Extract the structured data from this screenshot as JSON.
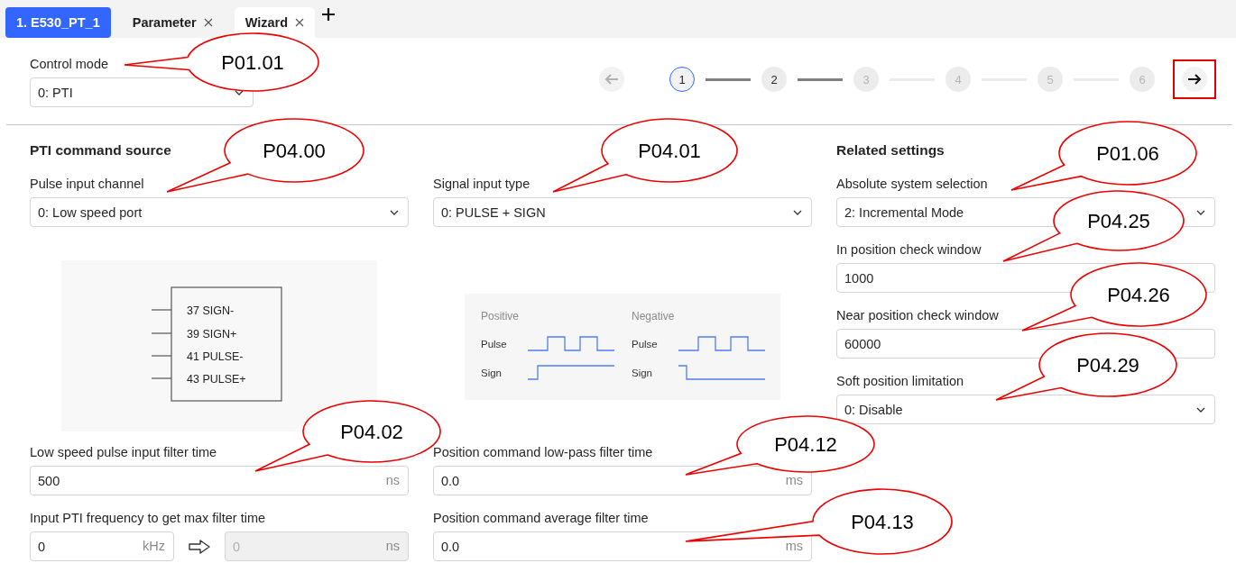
{
  "tabs": [
    {
      "label": "1. E530_PT_1",
      "kind": "device",
      "selected": false,
      "closable": false
    },
    {
      "label": "Parameter",
      "kind": "page",
      "selected": false,
      "closable": true
    },
    {
      "label": "Wizard",
      "kind": "page",
      "selected": true,
      "closable": true
    }
  ],
  "control_mode": {
    "label": "Control mode",
    "value": "0: PTI"
  },
  "stepper": {
    "back_disabled": true,
    "steps": [
      {
        "label": "1",
        "current": true,
        "disabled": false
      },
      {
        "label": "2",
        "current": false,
        "disabled": false
      },
      {
        "label": "3",
        "current": false,
        "disabled": true
      },
      {
        "label": "4",
        "current": false,
        "disabled": true
      },
      {
        "label": "5",
        "current": false,
        "disabled": true
      },
      {
        "label": "6",
        "current": false,
        "disabled": true
      }
    ],
    "next_highlighted": true
  },
  "main": {
    "heading": "PTI command source",
    "top_fields": [
      {
        "kind": "select",
        "label": "Pulse input channel",
        "value": "0: Low speed port"
      },
      {
        "kind": "select",
        "label": "Signal input type",
        "value": "0: PULSE + SIGN"
      }
    ],
    "diagrams": [
      {
        "kind": "wiring",
        "pins": [
          "37 SIGN-",
          "39 SIGN+",
          "41 PULSE-",
          "43 PULSE+"
        ]
      },
      {
        "kind": "timing",
        "panels": [
          {
            "title": "Positive",
            "kind": "positive",
            "rows": [
              "Pulse",
              "Sign"
            ]
          },
          {
            "title": "Negative",
            "kind": "negative",
            "rows": [
              "Pulse",
              "Sign"
            ]
          }
        ]
      }
    ],
    "bottom_fields": [
      {
        "kind": "number",
        "label": "Low speed pulse input filter time",
        "value": "500",
        "unit": "ns"
      },
      {
        "kind": "number",
        "label": "Position command low-pass filter time",
        "value": "0.0",
        "unit": "ms"
      },
      {
        "kind": "conversion",
        "label": "Input PTI frequency to get max filter time",
        "value": "0",
        "unit": "kHz",
        "result": "0",
        "result_unit": "ns",
        "result_disabled": true
      },
      {
        "kind": "number",
        "label": "Position command average filter time",
        "value": "0.0",
        "unit": "ms"
      }
    ]
  },
  "related": {
    "heading": "Related settings",
    "fields": [
      {
        "kind": "select",
        "label": "Absolute system selection",
        "value": "2: Incremental Mode"
      },
      {
        "kind": "number",
        "label": "In position check window",
        "value": "1000"
      },
      {
        "kind": "number",
        "label": "Near position check window",
        "value": "60000"
      },
      {
        "kind": "select",
        "label": "Soft position limitation",
        "value": "0: Disable"
      }
    ]
  },
  "callouts": [
    {
      "label": "P01.01"
    },
    {
      "label": "P04.00"
    },
    {
      "label": "P04.01"
    },
    {
      "label": "P01.06"
    },
    {
      "label": "P04.25"
    },
    {
      "label": "P04.26"
    },
    {
      "label": "P04.29"
    },
    {
      "label": "P04.02"
    },
    {
      "label": "P04.12"
    },
    {
      "label": "P04.13"
    }
  ]
}
